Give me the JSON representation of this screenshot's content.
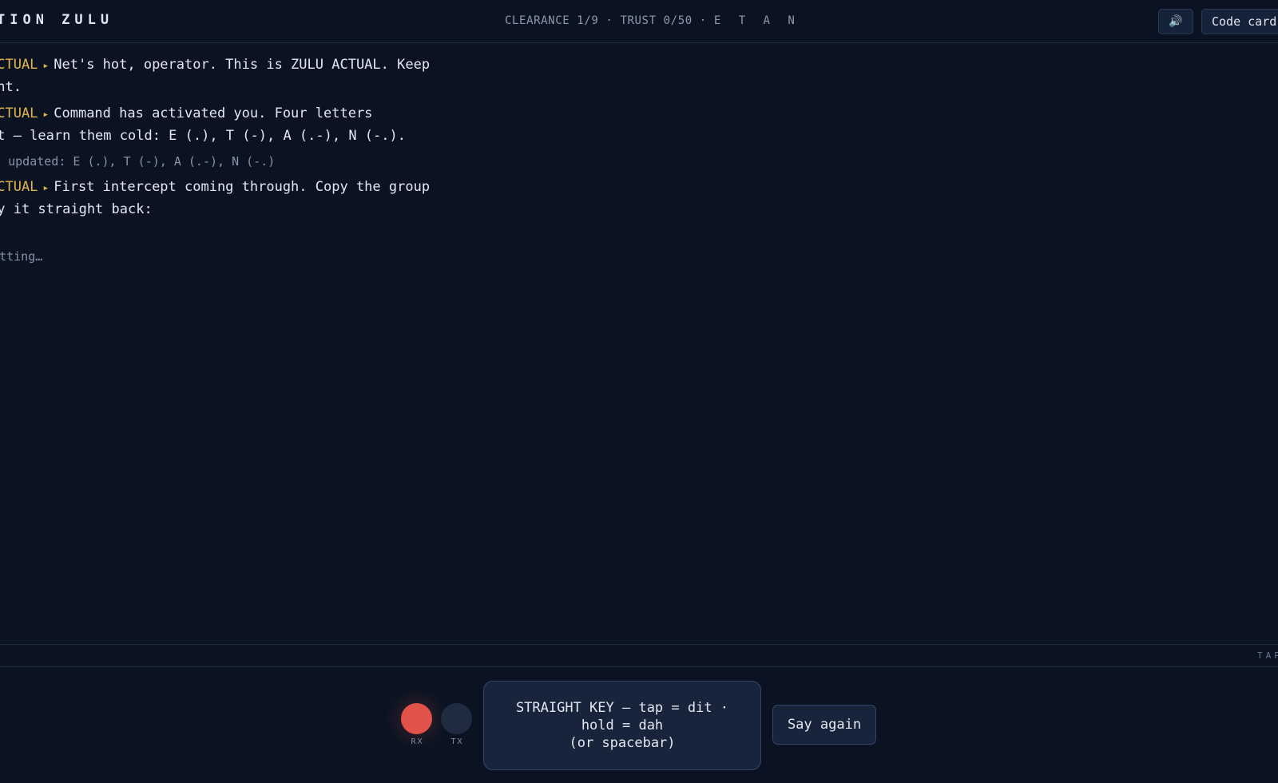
{
  "header": {
    "title": "TION ZULU",
    "status_prefix": "CLEARANCE 1/9 · TRUST 0/50 · ",
    "status_letters": "E T A N",
    "sound_icon": "🔊",
    "code_card_label": "Code card"
  },
  "transcript": {
    "m1": {
      "speaker": "ACTUAL",
      "separator": "▸",
      "line1": "Net's hot, operator. This is ZULU ACTUAL. Keep",
      "line2": "ght."
    },
    "m2": {
      "speaker": "ACTUAL",
      "separator": "▸",
      "line1": "Command has activated you. Four letters",
      "line2": "ht — learn them cold: E (.), T (-), A (.-), N (-.)."
    },
    "card_update": "ard updated: E (.), T (-), A (.-), N (-.)",
    "m3": {
      "speaker": "ACTUAL",
      "separator": "▸",
      "line1": "First intercept coming through. Copy the group",
      "line2": "ey it straight back:"
    },
    "group": ".",
    "status_note": "smitting…"
  },
  "tape": {
    "label": "TAP"
  },
  "controls": {
    "rx_label": "RX",
    "tx_label": "TX",
    "rx_color": "#e0524a",
    "tx_color": "#1f2b40",
    "key_line1": "STRAIGHT KEY — tap = dit ·",
    "key_line2": "hold = dah",
    "key_line3": "(or spacebar)",
    "say_again_label": "Say again"
  }
}
